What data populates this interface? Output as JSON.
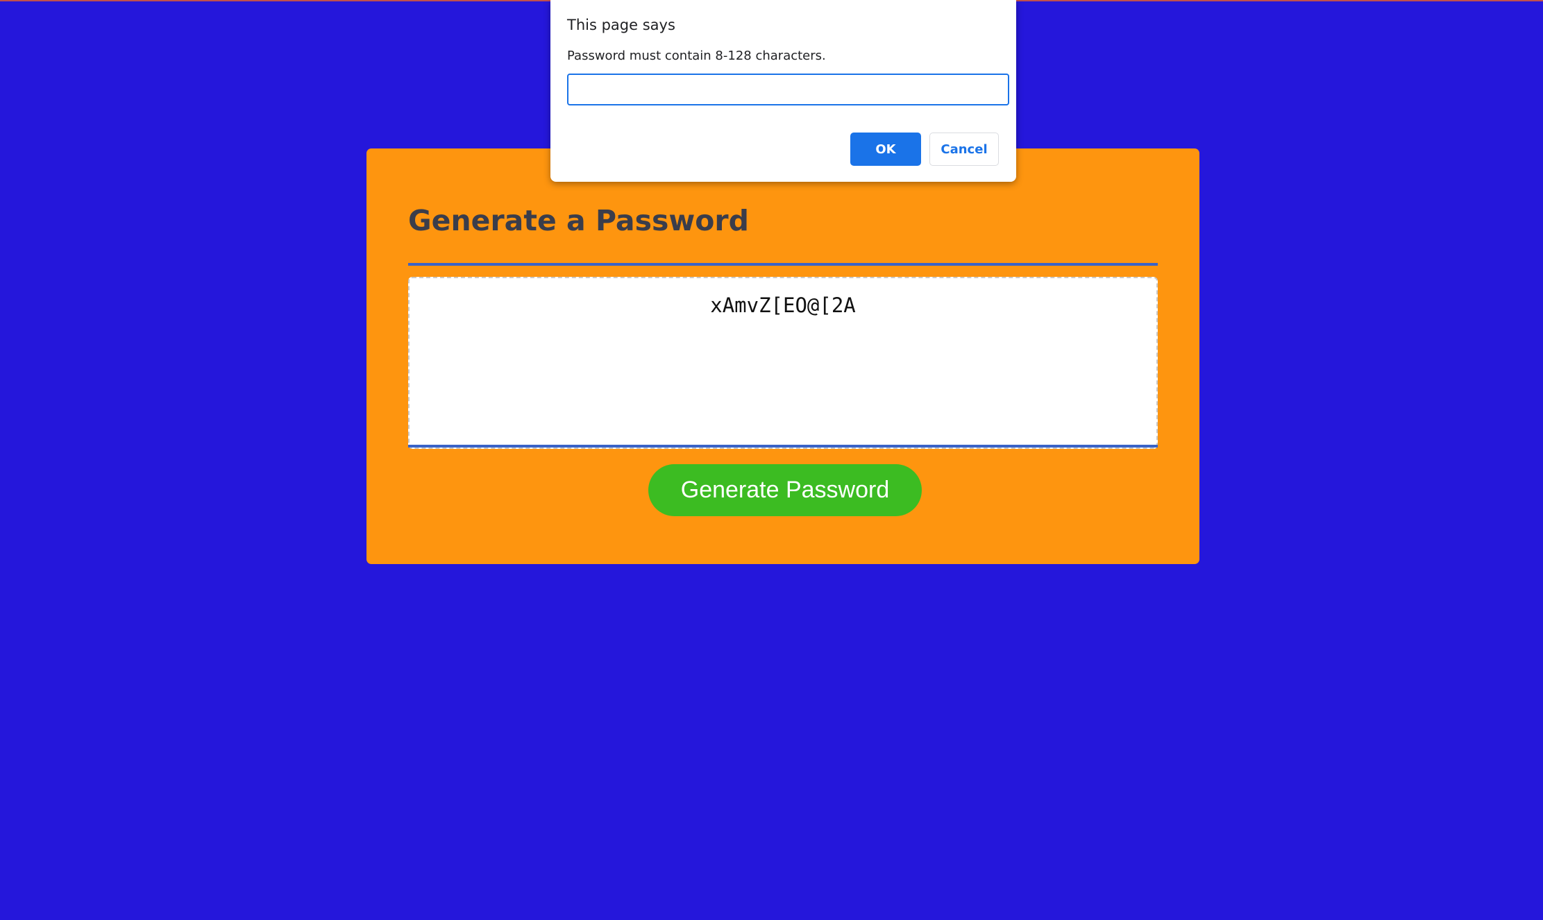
{
  "colors": {
    "background": "#2517db",
    "card": "#fe950f",
    "title": "#3a3d4b",
    "rule": "#3a63c7",
    "generate_button": "#3cbc22",
    "dialog_accent": "#1a73e8"
  },
  "card": {
    "title": "Generate a Password",
    "password_value": "xAmvZ[EO@[2A",
    "generate_button_label": "Generate Password"
  },
  "dialog": {
    "title": "This page says",
    "message": "Password must contain 8-128 characters.",
    "input_value": "",
    "ok_label": "OK",
    "cancel_label": "Cancel"
  }
}
